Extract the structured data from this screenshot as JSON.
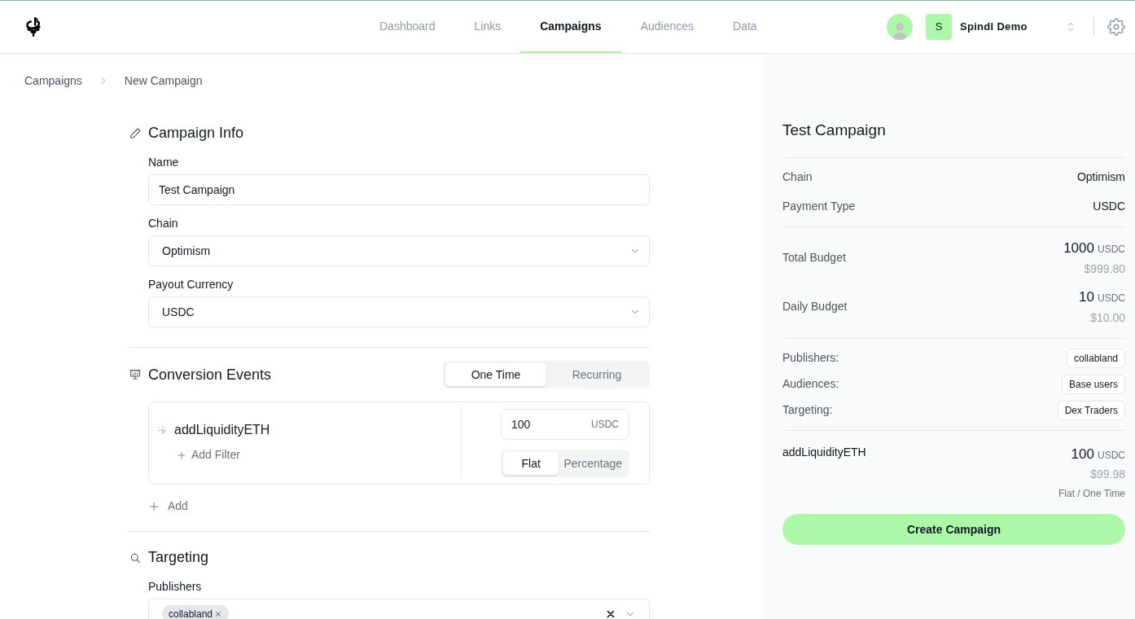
{
  "nav": {
    "items": [
      {
        "label": "Dashboard",
        "selected": false
      },
      {
        "label": "Links",
        "selected": false
      },
      {
        "label": "Campaigns",
        "selected": true
      },
      {
        "label": "Audiences",
        "selected": false
      },
      {
        "label": "Data",
        "selected": false
      }
    ],
    "workspace": {
      "initial": "S",
      "name": "Spindl Demo"
    }
  },
  "breadcrumb": [
    "Campaigns",
    "New Campaign"
  ],
  "campaign_info": {
    "title": "Campaign Info",
    "fields": [
      {
        "label": "Name",
        "kind": "text",
        "value": "Test Campaign"
      },
      {
        "label": "Chain",
        "kind": "select",
        "value": "Optimism"
      },
      {
        "label": "Payout Currency",
        "kind": "select",
        "value": "USDC"
      }
    ]
  },
  "conversion_events": {
    "title": "Conversion Events",
    "frequency_tabs": [
      {
        "label": "One Time",
        "selected": true
      },
      {
        "label": "Recurring",
        "selected": false
      }
    ],
    "events": [
      {
        "name": "addLiquidityETH",
        "add_filter": "Add Filter",
        "amount": "100",
        "unit": "USDC",
        "mode_tabs": [
          {
            "label": "Flat",
            "selected": true
          },
          {
            "label": "Percentage",
            "selected": false
          }
        ]
      }
    ],
    "add": "Add"
  },
  "targeting": {
    "title": "Targeting",
    "publishers": {
      "label": "Publishers",
      "tags": [
        "collabland"
      ]
    }
  },
  "summary": {
    "title": "Test Campaign",
    "details": [
      {
        "label": "Chain",
        "value": "Optimism"
      },
      {
        "label": "Payment Type",
        "value": "USDC"
      }
    ],
    "budgets": [
      {
        "label": "Total Budget",
        "amount": "1000",
        "unit": "USDC",
        "usd": "$999.80"
      },
      {
        "label": "Daily Budget",
        "amount": "10",
        "unit": "USDC",
        "usd": "$10.00"
      }
    ],
    "tags": [
      {
        "label": "Publishers:",
        "tag": "collabland"
      },
      {
        "label": "Audiences:",
        "tag": "Base users"
      },
      {
        "label": "Targeting:",
        "tag": "Dex Traders"
      }
    ],
    "events": [
      {
        "name": "addLiquidityETH",
        "amount": "100",
        "unit": "USDC",
        "usd": "$99.98",
        "detail": "Flat / One Time"
      }
    ],
    "create_button": "Create Campaign"
  }
}
